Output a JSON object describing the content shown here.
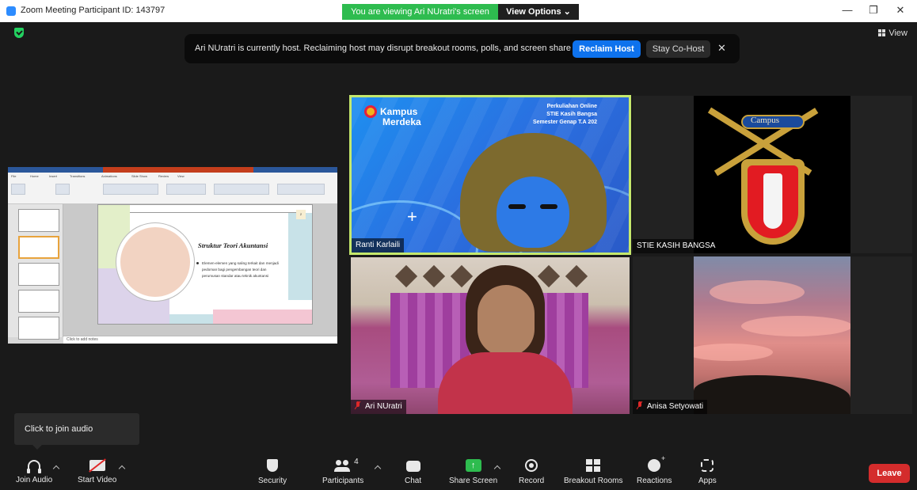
{
  "window": {
    "title": "Zoom Meeting Participant ID: 143797",
    "viewing_text": "You are viewing Ari NUratri's screen",
    "view_options_label": "View Options ⌄",
    "minimize": "—",
    "restore": "❐",
    "close": "✕"
  },
  "stage": {
    "view_label": "View"
  },
  "banner": {
    "text": "Ari NUratri is currently host. Reclaiming host may disrupt breakout rooms, polls, and screen share",
    "reclaim_label": "Reclaim Host",
    "cohost_label": "Stay Co-Host",
    "close": "✕"
  },
  "shared_screen": {
    "ribbon_tabs": [
      "File",
      "Home",
      "Insert",
      "Transitions",
      "Animations",
      "Slide Show",
      "Review",
      "View"
    ],
    "slide_title": "Struktur Teori Akuntansi",
    "slide_bullet": "Elemen-elemen yang saling terkait dan menjadi pedoman bagi pengembangan teori dan perumusan standar atau teknik akuntansi",
    "slide_number": "2",
    "notes_placeholder": "Click to add notes",
    "slide_colors": {
      "green": "#e3efc9",
      "teal": "#c8e2e8",
      "lavender": "#dcd3ea",
      "pink": "#f4c6d3",
      "peach": "#f2d3c2"
    }
  },
  "participants": [
    {
      "name": "Ranti Karlaili",
      "muted": false,
      "active_speaker": true
    },
    {
      "name": "STIE KASIH BANGSA",
      "muted": false,
      "active_speaker": false
    },
    {
      "name": "Ari NUratri",
      "muted": true,
      "active_speaker": false
    },
    {
      "name": "Anisa Setyowati",
      "muted": true,
      "active_speaker": false
    }
  ],
  "ranti_background": {
    "logo_text_1": "Kampus",
    "logo_text_2": "Merdeka",
    "course_line_1": "Perkuliahan Online",
    "course_line_2": "STIE Kasih Bangsa",
    "course_line_3": "Semester Genap T.A 202"
  },
  "stie_logo": {
    "banner_text": "Campus"
  },
  "tooltip": {
    "text": "Click to join audio"
  },
  "toolbar": {
    "join_audio": "Join Audio",
    "start_video": "Start Video",
    "security": "Security",
    "participants": "Participants",
    "participants_count": "4",
    "chat": "Chat",
    "share_screen": "Share Screen",
    "share_icon": "↑",
    "record": "Record",
    "breakout_rooms": "Breakout Rooms",
    "reactions": "Reactions",
    "apps": "Apps",
    "leave": "Leave"
  },
  "colors": {
    "accent_blue": "#0e72ed",
    "share_green": "#2ebc4f",
    "active_speaker": "#c5e86c",
    "leave_red": "#d42c2c",
    "muted_red": "#e02828"
  }
}
